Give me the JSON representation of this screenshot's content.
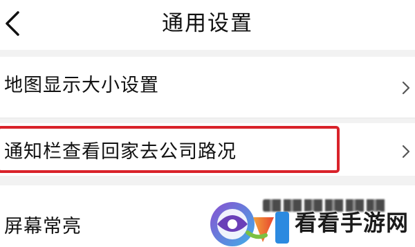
{
  "header": {
    "title": "通用设置",
    "back_icon": "chevron-left-icon"
  },
  "settings": [
    {
      "label": "地图显示大小设置",
      "icon": "chevron-right-icon"
    },
    {
      "label": "通知栏查看回家去公司路况",
      "icon": "chevron-right-icon",
      "highlighted": true
    },
    {
      "label": "屏幕常亮"
    }
  ],
  "watermark": {
    "text": "看看手游网",
    "logo": "kankan-logo"
  },
  "colors": {
    "highlight_border": "#d9222a",
    "background": "#ffffff",
    "gap": "#f2f2f2",
    "text": "#111111",
    "chevron": "#555555"
  }
}
